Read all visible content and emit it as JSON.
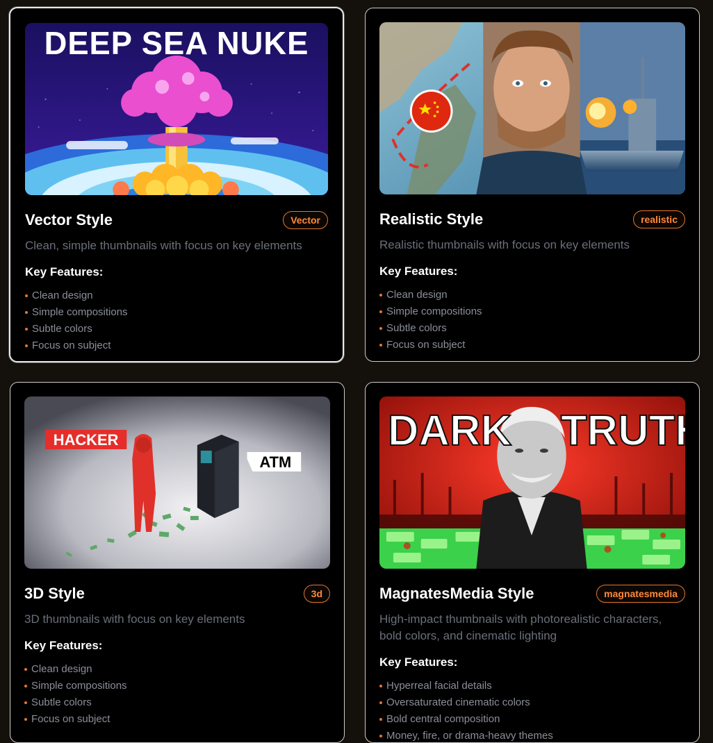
{
  "cards": [
    {
      "title": "Vector Style",
      "badge": "Vector",
      "description": "Clean, simple thumbnails with focus on key elements",
      "features_title": "Key Features:",
      "features": [
        "Clean design",
        "Simple compositions",
        "Subtle colors",
        "Focus on subject"
      ],
      "thumbnail_text": "DEEP SEA NUKE",
      "selected": true
    },
    {
      "title": "Realistic Style",
      "badge": "realistic",
      "description": "Realistic thumbnails with focus on key elements",
      "features_title": "Key Features:",
      "features": [
        "Clean design",
        "Simple compositions",
        "Subtle colors",
        "Focus on subject"
      ]
    },
    {
      "title": "3D Style",
      "badge": "3d",
      "description": "3D thumbnails with focus on key elements",
      "features_title": "Key Features:",
      "features": [
        "Clean design",
        "Simple compositions",
        "Subtle colors",
        "Focus on subject"
      ],
      "thumbnail_labels": [
        "HACKER",
        "ATM"
      ]
    },
    {
      "title": "MagnatesMedia Style",
      "badge": "magnatesmedia",
      "description": "High-impact thumbnails with photorealistic characters, bold colors, and cinematic lighting",
      "features_title": "Key Features:",
      "features": [
        "Hyperreal facial details",
        "Oversaturated cinematic colors",
        "Bold central composition",
        "Money, fire, or drama-heavy themes"
      ],
      "thumbnail_words": [
        "DARK",
        "TRUTH"
      ]
    }
  ],
  "colors": {
    "accent": "#e2772f",
    "background": "#14100b",
    "card": "#000000",
    "muted_text": "#6b6f7a"
  }
}
